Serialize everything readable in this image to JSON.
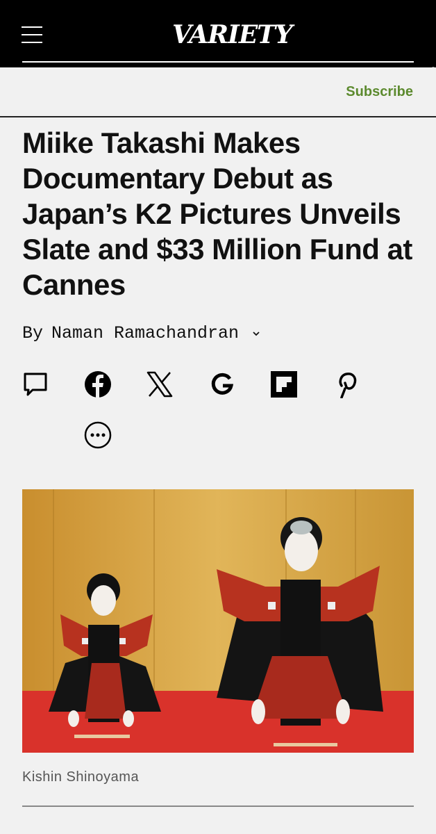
{
  "header": {
    "logo_text": "VARIETY",
    "menu_icon": "hamburger-menu-icon"
  },
  "subscribe": {
    "label": "Subscribe",
    "color": "#5c8a2e"
  },
  "article": {
    "headline": "Miike Takashi Makes Documentary Debut as Japan’s K2 Pictures Unveils Slate and $33 Million Fund at Cannes",
    "byline_prefix": "By",
    "author": "Naman Ramachandran"
  },
  "share": {
    "icons": [
      "comment-icon",
      "facebook-icon",
      "x-icon",
      "google-icon",
      "flipboard-icon",
      "pinterest-icon",
      "more-icon"
    ]
  },
  "image": {
    "caption": "Kishin Shinoyama",
    "background_color": "#d9a93f",
    "floor_color": "#d9322b"
  }
}
